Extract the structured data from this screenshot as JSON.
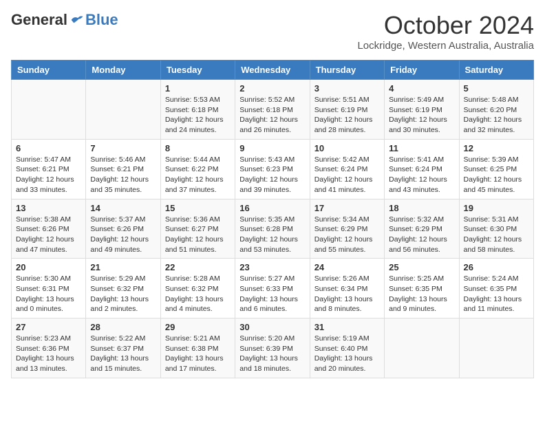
{
  "logo": {
    "general": "General",
    "blue": "Blue"
  },
  "header": {
    "title": "October 2024",
    "location": "Lockridge, Western Australia, Australia"
  },
  "weekdays": [
    "Sunday",
    "Monday",
    "Tuesday",
    "Wednesday",
    "Thursday",
    "Friday",
    "Saturday"
  ],
  "weeks": [
    [
      {
        "day": "",
        "info": ""
      },
      {
        "day": "",
        "info": ""
      },
      {
        "day": "1",
        "info": "Sunrise: 5:53 AM\nSunset: 6:18 PM\nDaylight: 12 hours and 24 minutes."
      },
      {
        "day": "2",
        "info": "Sunrise: 5:52 AM\nSunset: 6:18 PM\nDaylight: 12 hours and 26 minutes."
      },
      {
        "day": "3",
        "info": "Sunrise: 5:51 AM\nSunset: 6:19 PM\nDaylight: 12 hours and 28 minutes."
      },
      {
        "day": "4",
        "info": "Sunrise: 5:49 AM\nSunset: 6:19 PM\nDaylight: 12 hours and 30 minutes."
      },
      {
        "day": "5",
        "info": "Sunrise: 5:48 AM\nSunset: 6:20 PM\nDaylight: 12 hours and 32 minutes."
      }
    ],
    [
      {
        "day": "6",
        "info": "Sunrise: 5:47 AM\nSunset: 6:21 PM\nDaylight: 12 hours and 33 minutes."
      },
      {
        "day": "7",
        "info": "Sunrise: 5:46 AM\nSunset: 6:21 PM\nDaylight: 12 hours and 35 minutes."
      },
      {
        "day": "8",
        "info": "Sunrise: 5:44 AM\nSunset: 6:22 PM\nDaylight: 12 hours and 37 minutes."
      },
      {
        "day": "9",
        "info": "Sunrise: 5:43 AM\nSunset: 6:23 PM\nDaylight: 12 hours and 39 minutes."
      },
      {
        "day": "10",
        "info": "Sunrise: 5:42 AM\nSunset: 6:24 PM\nDaylight: 12 hours and 41 minutes."
      },
      {
        "day": "11",
        "info": "Sunrise: 5:41 AM\nSunset: 6:24 PM\nDaylight: 12 hours and 43 minutes."
      },
      {
        "day": "12",
        "info": "Sunrise: 5:39 AM\nSunset: 6:25 PM\nDaylight: 12 hours and 45 minutes."
      }
    ],
    [
      {
        "day": "13",
        "info": "Sunrise: 5:38 AM\nSunset: 6:26 PM\nDaylight: 12 hours and 47 minutes."
      },
      {
        "day": "14",
        "info": "Sunrise: 5:37 AM\nSunset: 6:26 PM\nDaylight: 12 hours and 49 minutes."
      },
      {
        "day": "15",
        "info": "Sunrise: 5:36 AM\nSunset: 6:27 PM\nDaylight: 12 hours and 51 minutes."
      },
      {
        "day": "16",
        "info": "Sunrise: 5:35 AM\nSunset: 6:28 PM\nDaylight: 12 hours and 53 minutes."
      },
      {
        "day": "17",
        "info": "Sunrise: 5:34 AM\nSunset: 6:29 PM\nDaylight: 12 hours and 55 minutes."
      },
      {
        "day": "18",
        "info": "Sunrise: 5:32 AM\nSunset: 6:29 PM\nDaylight: 12 hours and 56 minutes."
      },
      {
        "day": "19",
        "info": "Sunrise: 5:31 AM\nSunset: 6:30 PM\nDaylight: 12 hours and 58 minutes."
      }
    ],
    [
      {
        "day": "20",
        "info": "Sunrise: 5:30 AM\nSunset: 6:31 PM\nDaylight: 13 hours and 0 minutes."
      },
      {
        "day": "21",
        "info": "Sunrise: 5:29 AM\nSunset: 6:32 PM\nDaylight: 13 hours and 2 minutes."
      },
      {
        "day": "22",
        "info": "Sunrise: 5:28 AM\nSunset: 6:32 PM\nDaylight: 13 hours and 4 minutes."
      },
      {
        "day": "23",
        "info": "Sunrise: 5:27 AM\nSunset: 6:33 PM\nDaylight: 13 hours and 6 minutes."
      },
      {
        "day": "24",
        "info": "Sunrise: 5:26 AM\nSunset: 6:34 PM\nDaylight: 13 hours and 8 minutes."
      },
      {
        "day": "25",
        "info": "Sunrise: 5:25 AM\nSunset: 6:35 PM\nDaylight: 13 hours and 9 minutes."
      },
      {
        "day": "26",
        "info": "Sunrise: 5:24 AM\nSunset: 6:35 PM\nDaylight: 13 hours and 11 minutes."
      }
    ],
    [
      {
        "day": "27",
        "info": "Sunrise: 5:23 AM\nSunset: 6:36 PM\nDaylight: 13 hours and 13 minutes."
      },
      {
        "day": "28",
        "info": "Sunrise: 5:22 AM\nSunset: 6:37 PM\nDaylight: 13 hours and 15 minutes."
      },
      {
        "day": "29",
        "info": "Sunrise: 5:21 AM\nSunset: 6:38 PM\nDaylight: 13 hours and 17 minutes."
      },
      {
        "day": "30",
        "info": "Sunrise: 5:20 AM\nSunset: 6:39 PM\nDaylight: 13 hours and 18 minutes."
      },
      {
        "day": "31",
        "info": "Sunrise: 5:19 AM\nSunset: 6:40 PM\nDaylight: 13 hours and 20 minutes."
      },
      {
        "day": "",
        "info": ""
      },
      {
        "day": "",
        "info": ""
      }
    ]
  ]
}
